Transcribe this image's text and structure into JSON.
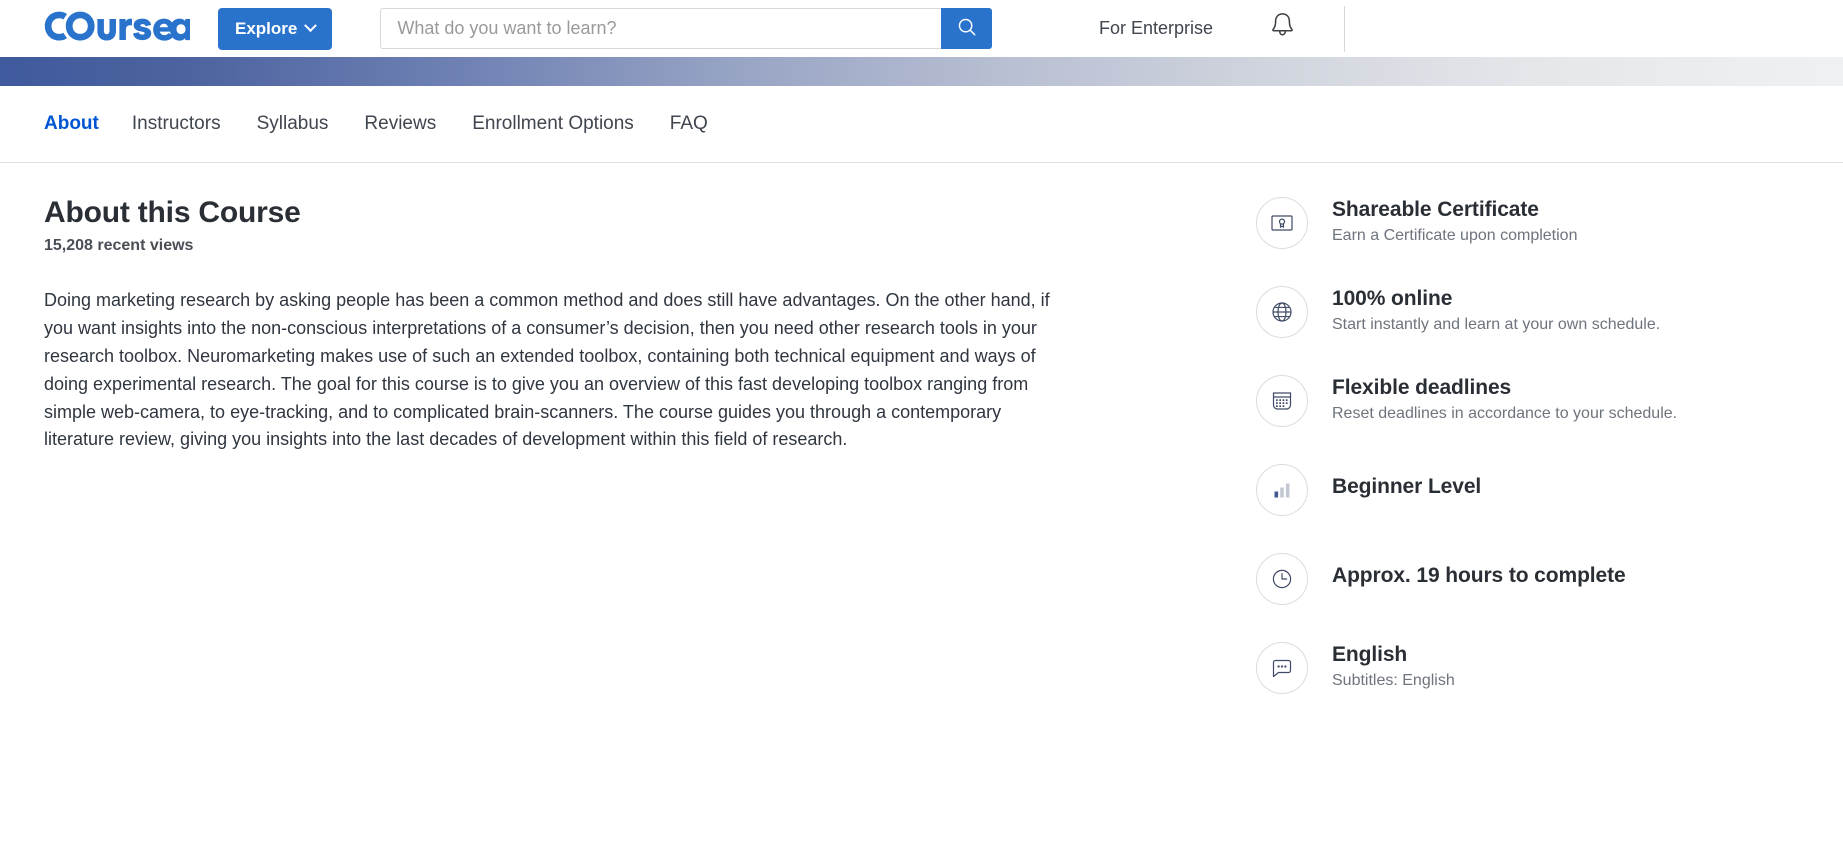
{
  "header": {
    "logo_text": "coursera",
    "logo_icon": "coursera-logo",
    "explore_label": "Explore",
    "explore_icon": "chevron-down-icon",
    "search": {
      "placeholder": "What do you want to learn?",
      "value": "",
      "button_icon": "search-icon"
    },
    "for_enterprise_label": "For Enterprise",
    "notifications_icon": "bell-icon",
    "accent_color": "#2a73cc"
  },
  "banner": {
    "gradient_from": "#3f5a9d",
    "gradient_to": "#eef0f2"
  },
  "tabs": [
    {
      "label": "About",
      "active": true
    },
    {
      "label": "Instructors",
      "active": false
    },
    {
      "label": "Syllabus",
      "active": false
    },
    {
      "label": "Reviews",
      "active": false
    },
    {
      "label": "Enrollment Options",
      "active": false
    },
    {
      "label": "FAQ",
      "active": false
    }
  ],
  "main": {
    "title": "About this Course",
    "recent_views": "15,208 recent views",
    "description": "Doing marketing research by asking people has been a common method and does still have advantages. On the other hand, if you want insights into the non-conscious interpretations of a consumer’s decision, then you need other research tools in your research toolbox. Neuromarketing makes use of such an extended toolbox, containing both technical equipment and ways of doing experimental research. The goal for this course is to give you an overview of this fast developing toolbox ranging from simple web-camera, to eye-tracking, and to complicated brain-scanners. The course guides you through a contemporary literature review, giving you insights into the last decades of development  within this field of research."
  },
  "sidebar": {
    "items": [
      {
        "icon": "certificate-icon",
        "title": "Shareable Certificate",
        "subtitle": "Earn a Certificate upon completion"
      },
      {
        "icon": "globe-icon",
        "title": "100% online",
        "subtitle": "Start instantly and learn at your own schedule."
      },
      {
        "icon": "calendar-icon",
        "title": "Flexible deadlines",
        "subtitle": "Reset deadlines in accordance to your schedule."
      },
      {
        "icon": "bar-chart-icon",
        "title": "Beginner Level",
        "subtitle": ""
      },
      {
        "icon": "clock-icon",
        "title": "Approx. 19 hours to complete",
        "subtitle": ""
      },
      {
        "icon": "subtitles-icon",
        "title": "English",
        "subtitle": "Subtitles: English"
      }
    ]
  }
}
